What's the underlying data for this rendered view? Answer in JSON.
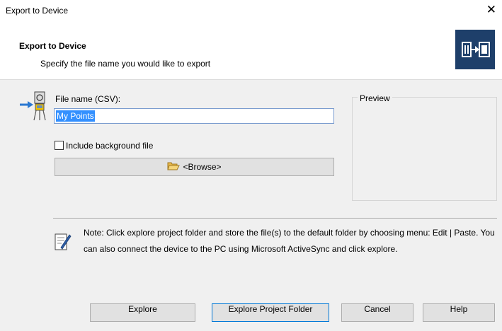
{
  "window": {
    "title": "Export to Device",
    "close_glyph": "✕"
  },
  "header": {
    "title": "Export to Device",
    "subtitle": "Specify the file name you would like to export",
    "icon": "export-device-icon"
  },
  "form": {
    "file_name_label": "File name (CSV):",
    "file_name_value": "My Points",
    "include_background_label": "Include background file",
    "include_background_checked": false,
    "browse_label": "<Browse>",
    "preview_label": "Preview"
  },
  "note": {
    "text": "Note: Click explore project folder and store the file(s) to the default folder by choosing menu: Edit | Paste. You can also connect the device to the PC using Microsoft ActiveSync and click explore."
  },
  "buttons": {
    "explore": "Explore",
    "explore_project_folder": "Explore Project Folder",
    "cancel": "Cancel",
    "help": "Help"
  },
  "colors": {
    "selection": "#3390ff",
    "header_icon_bg": "#1e3f6a",
    "body_bg": "#f0f0f0"
  }
}
